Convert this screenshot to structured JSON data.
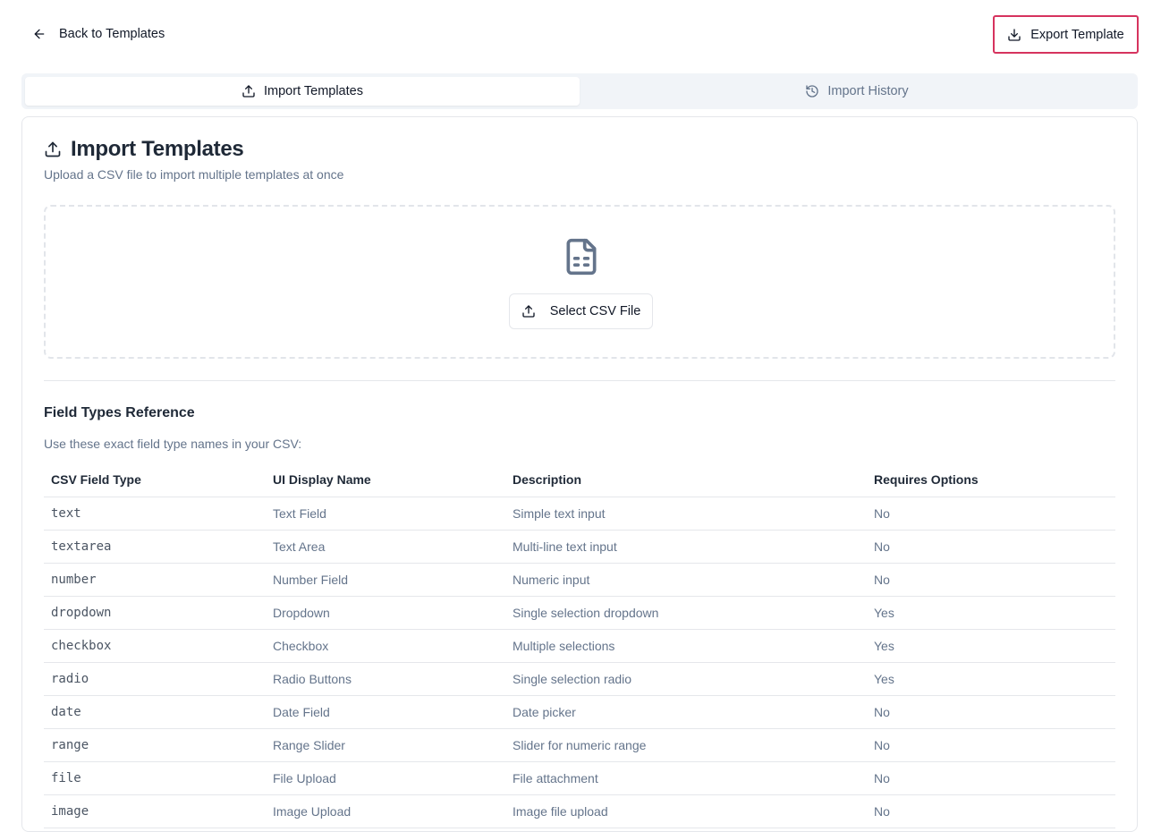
{
  "header": {
    "back_label": "Back to Templates",
    "export_label": "Export Template",
    "export_border_color": "#d6335e"
  },
  "tabs": [
    {
      "label": "Import Templates",
      "icon": "upload-icon",
      "active": true
    },
    {
      "label": "Import History",
      "icon": "history-icon",
      "active": false
    }
  ],
  "card": {
    "title": "Import Templates",
    "subtitle": "Upload a CSV file to import multiple templates at once",
    "select_label": "Select CSV File",
    "reference_title": "Field Types Reference",
    "reference_subtitle": "Use these exact field type names in your CSV:"
  },
  "table": {
    "headers": [
      "CSV Field Type",
      "UI Display Name",
      "Description",
      "Requires Options"
    ],
    "rows": [
      [
        "text",
        "Text Field",
        "Simple text input",
        "No"
      ],
      [
        "textarea",
        "Text Area",
        "Multi-line text input",
        "No"
      ],
      [
        "number",
        "Number Field",
        "Numeric input",
        "No"
      ],
      [
        "dropdown",
        "Dropdown",
        "Single selection dropdown",
        "Yes"
      ],
      [
        "checkbox",
        "Checkbox",
        "Multiple selections",
        "Yes"
      ],
      [
        "radio",
        "Radio Buttons",
        "Single selection radio",
        "Yes"
      ],
      [
        "date",
        "Date Field",
        "Date picker",
        "No"
      ],
      [
        "range",
        "Range Slider",
        "Slider for numeric range",
        "No"
      ],
      [
        "file",
        "File Upload",
        "File attachment",
        "No"
      ],
      [
        "image",
        "Image Upload",
        "Image file upload",
        "No"
      ]
    ]
  }
}
